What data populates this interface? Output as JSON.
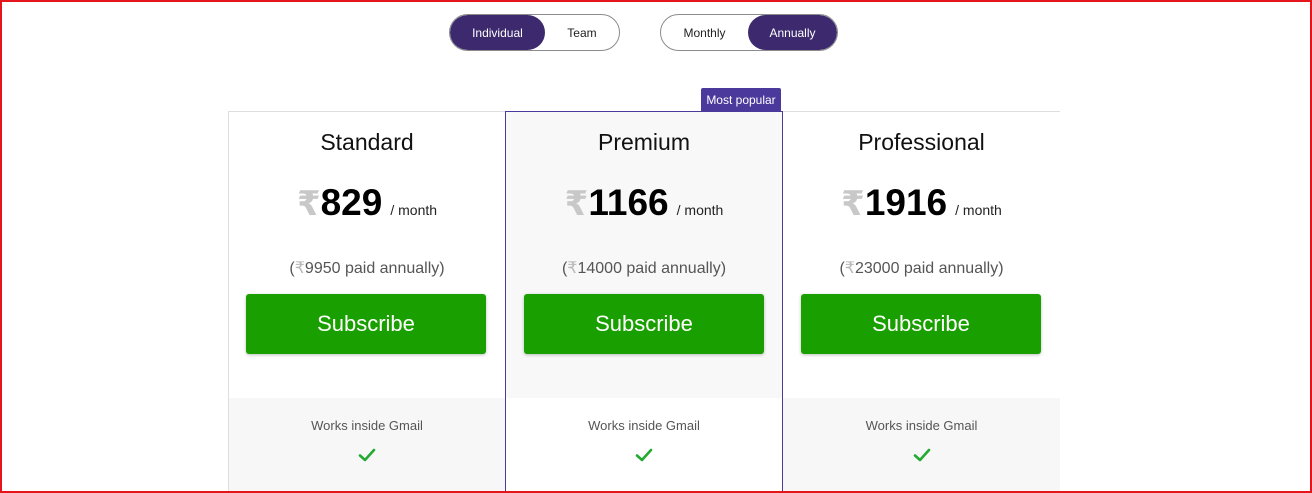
{
  "plan_toggle": {
    "options": [
      "Individual",
      "Team"
    ],
    "selected": "Individual"
  },
  "billing_toggle": {
    "options": [
      "Monthly",
      "Annually"
    ],
    "selected": "Annually"
  },
  "badge": "Most popular",
  "currency_symbol": "₹",
  "plans": [
    {
      "name": "Standard",
      "price": "829",
      "period": "/ month",
      "annual_open": "(",
      "annual_amount": "9950 paid annually)",
      "button": "Subscribe",
      "feature": "Works inside Gmail",
      "feature_included": true
    },
    {
      "name": "Premium",
      "price": "1166",
      "period": "/ month",
      "annual_open": "(",
      "annual_amount": "14000 paid annually)",
      "button": "Subscribe",
      "feature": "Works inside Gmail",
      "feature_included": true
    },
    {
      "name": "Professional",
      "price": "1916",
      "period": "/ month",
      "annual_open": "(",
      "annual_amount": "23000 paid annually)",
      "button": "Subscribe",
      "feature": "Works inside Gmail",
      "feature_included": true
    }
  ],
  "colors": {
    "accent": "#3d2a6e",
    "popular_border": "#4b3a9c",
    "subscribe": "#19a000",
    "check": "#22aa33"
  },
  "icons": {
    "feature_check": "check-icon"
  }
}
